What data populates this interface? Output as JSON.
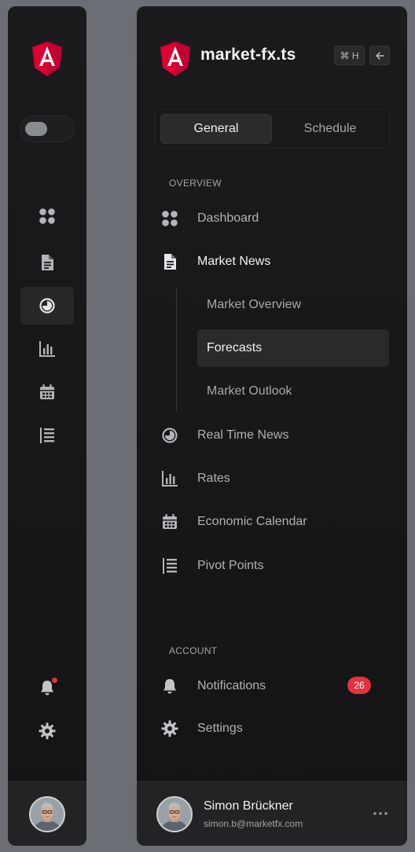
{
  "app": {
    "title": "market-fx.ts",
    "shortcut": "⌘ H"
  },
  "tabs": [
    {
      "label": "General"
    },
    {
      "label": "Schedule"
    }
  ],
  "sections": {
    "overview": "OVERVIEW",
    "account": "ACCOUNT"
  },
  "nav": {
    "dashboard": "Dashboard",
    "market_news": "Market News",
    "market_news_children": [
      "Market Overview",
      "Forecasts",
      "Market Outlook"
    ],
    "real_time_news": "Real Time News",
    "rates": "Rates",
    "economic_calendar": "Economic Calendar",
    "pivot_points": "Pivot Points"
  },
  "account": {
    "notifications": "Notifications",
    "notifications_count": "26",
    "settings": "Settings"
  },
  "user": {
    "name": "Simon Brückner",
    "email": "simon.b@marketfx.com"
  },
  "colors": {
    "accent_red": "#e5323e",
    "angular_red": "#dd0031",
    "panel_bg": "#18181a"
  },
  "icons": {
    "logo": "angular-logo-icon",
    "dashboard": "grid-icon",
    "market_news": "document-icon",
    "real_time_news": "pie-clock-icon",
    "rates": "bar-chart-icon",
    "economic_calendar": "calendar-icon",
    "pivot_points": "list-icon",
    "notifications": "bell-icon",
    "settings": "gear-icon"
  }
}
